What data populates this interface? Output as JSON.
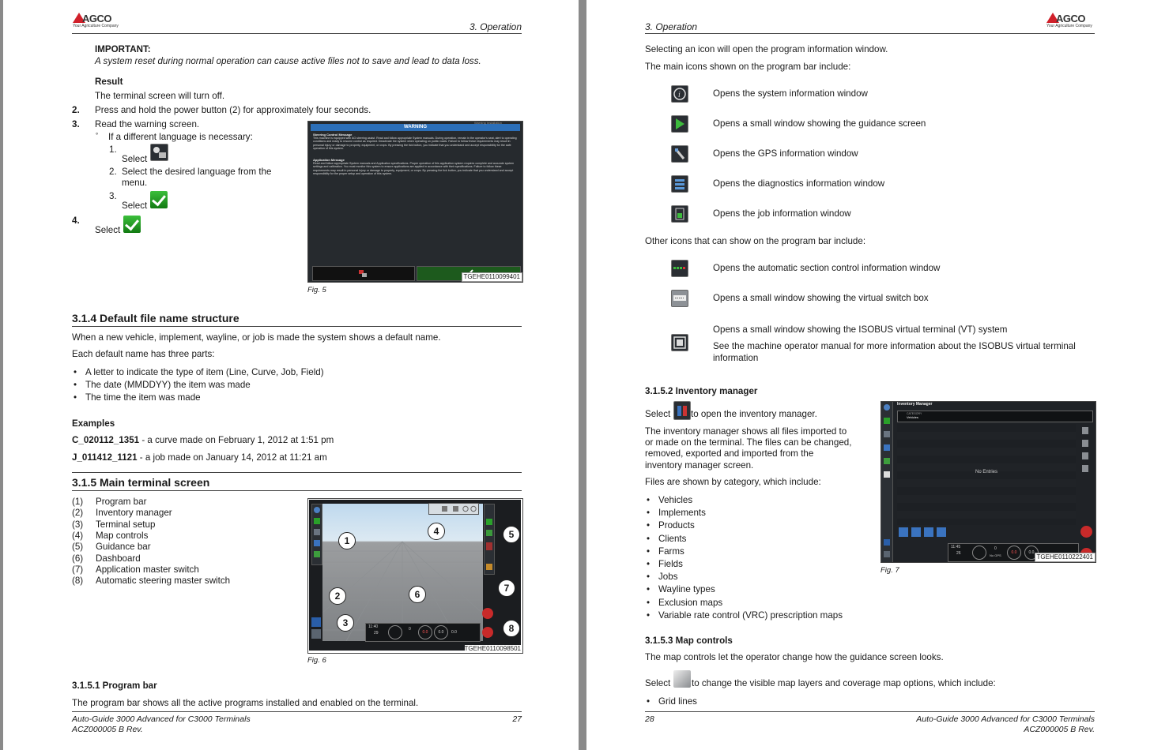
{
  "left_page": {
    "header": {
      "logo": "AGCO",
      "logo_tag": "Your Agriculture Company",
      "section": "3. Operation"
    },
    "important_label": "IMPORTANT:",
    "important_text": "A system reset during normal operation can cause active files not to save and lead to data loss.",
    "result_label": "Result",
    "result_text": "The terminal screen will turn off.",
    "steps": [
      {
        "num": "2.",
        "text": "Press and hold the power button (2) for approximately four seconds."
      },
      {
        "num": "3.",
        "text": "Read the warning screen."
      }
    ],
    "sub_bullet": "If a different language is necessary:",
    "substeps": [
      {
        "num": "1.",
        "text": "Select"
      },
      {
        "num": "2.",
        "text": "Select the desired language from the",
        "text2": "menu."
      },
      {
        "num": "3.",
        "text": "Select"
      }
    ],
    "step4": {
      "num": "4.",
      "text": "Select"
    },
    "fig5": {
      "caption": "Fig. 5",
      "id": "TGEHE0110099401",
      "warning_title": "WARNING",
      "top_right": "Warning Installation",
      "para1_title": "Steering Control Message",
      "para1": "This machine is equipped with AG steering assist. Read and follow appropriate System manuals. During operation, remain in the operator's seat, alert to operating conditions and ready to resume control as required. Deactivate the system when operating on public roads. Failure to follow these requirements may result in personal injury or damage to property, equipment, or crops. By pressing the tick button, you indicate that you understand and accept responsibility for the safe operation of this system.",
      "para2_title": "Application Message",
      "para2": "Read and follow appropriate System manuals and Application specifications. Proper operation of this application system requires complete and accurate system settings and calibration. You must monitor this system to ensure applications are applied in accordance with their specifications. Failure to follow these requirements may result in personal injury or damage to property, equipment, or crops. By pressing the tick button, you indicate that you understand and accept responsibility for the proper setup and operation of this system."
    },
    "sec314": {
      "title": "3.1.4  Default file name structure",
      "p1": "When a new vehicle, implement, wayline, or job is made the system shows a default name.",
      "p2": "Each default name has three parts:",
      "bullets": [
        "A letter to indicate the type of item (Line, Curve, Job, Field)",
        "The date (MMDDYY) the item was made",
        "The time the item was made"
      ],
      "examples_label": "Examples",
      "examples": [
        {
          "code": "C_020112_1351",
          "desc": " - a curve made on February 1, 2012 at 1:51 pm"
        },
        {
          "code": "J_011412_1121",
          "desc": " - a job made on January 14, 2012 at 11:21 am"
        }
      ]
    },
    "sec315": {
      "title": "3.1.5  Main terminal screen",
      "items": [
        {
          "num": "(1)",
          "label": "Program bar"
        },
        {
          "num": "(2)",
          "label": "Inventory manager"
        },
        {
          "num": "(3)",
          "label": "Terminal setup"
        },
        {
          "num": "(4)",
          "label": "Map controls"
        },
        {
          "num": "(5)",
          "label": "Guidance bar"
        },
        {
          "num": "(6)",
          "label": "Dashboard"
        },
        {
          "num": "(7)",
          "label": "Application master switch"
        },
        {
          "num": "(8)",
          "label": "Automatic steering master switch"
        }
      ]
    },
    "fig6": {
      "caption": "Fig. 6",
      "id": "TGEHE0110098501",
      "callouts": [
        "1",
        "2",
        "3",
        "4",
        "5",
        "6",
        "7",
        "8"
      ],
      "dash_time": "11:40",
      "dash_day": "29",
      "dash_vals": [
        "0",
        "0.0",
        "0.0",
        "0.0"
      ]
    },
    "sec3151": {
      "title": "3.1.5.1  Program bar",
      "p": "The program bar shows all the active programs installed and enabled on the terminal."
    },
    "footer": {
      "title": "Auto-Guide 3000 Advanced for C3000 Terminals",
      "doc": "ACZ000005 B Rev.",
      "page": "27"
    }
  },
  "right_page": {
    "header": {
      "logo": "AGCO",
      "logo_tag": "Your Agriculture Company",
      "section": "3. Operation"
    },
    "p1": "Selecting an icon will open the program information window.",
    "p2": "The main icons shown on the program bar include:",
    "main_icons": [
      {
        "icon": "info-icon",
        "text": "Opens the system information window"
      },
      {
        "icon": "guidance-icon",
        "text": "Opens a small window showing the guidance screen"
      },
      {
        "icon": "gps-icon",
        "text": "Opens the GPS information window"
      },
      {
        "icon": "diagnostics-icon",
        "text": "Opens the diagnostics information window"
      },
      {
        "icon": "job-icon",
        "text": "Opens the job information window"
      }
    ],
    "p3": "Other icons that can show on the program bar include:",
    "other_icons": [
      {
        "icon": "section-control-icon",
        "text": "Opens the automatic section control information window"
      },
      {
        "icon": "virtual-switch-icon",
        "text": "Opens a small window showing the virtual switch box"
      }
    ],
    "isobus": {
      "icon": "isobus-vt-icon",
      "text": "Opens a small window showing the ISOBUS virtual terminal (VT) system",
      "note1": "See the machine operator manual for more information about the ISOBUS virtual terminal",
      "note2": "information"
    },
    "sec3152": {
      "title": "3.1.5.2  Inventory manager",
      "select": "Select",
      "select_after": " to open the inventory manager.",
      "p1_lines": [
        "The inventory manager shows all files imported to",
        "or made on the terminal. The files can be changed,",
        "removed, exported and imported from the",
        "inventory manager screen."
      ],
      "p2": "Files are shown by category, which include:",
      "categories": [
        "Vehicles",
        "Implements",
        "Products",
        "Clients",
        "Farms",
        "Fields",
        "Jobs",
        "Wayline types",
        "Exclusion maps",
        "Variable rate control (VRC) prescription maps"
      ]
    },
    "fig7": {
      "caption": "Fig. 7",
      "id": "TGEHE0110222401",
      "title": "Inventory Manager",
      "category_label": "CATEGORY",
      "category_value": "Vehicles",
      "empty": "No Entries",
      "dash_time": "11:45",
      "dash_day": "26",
      "dash_vals": [
        "0",
        "0.0",
        "0.0"
      ],
      "dash_gps": "No GPS"
    },
    "sec3153": {
      "title": "3.1.5.3  Map controls",
      "p": "The map controls let the operator change how the guidance screen looks.",
      "select": "Select",
      "select_after": " to change the visible map layers and coverage map options, which include:",
      "bullets": [
        "Grid lines"
      ]
    },
    "footer": {
      "title": "Auto-Guide 3000 Advanced for C3000 Terminals",
      "doc": "ACZ000005 B Rev.",
      "page": "28"
    }
  }
}
